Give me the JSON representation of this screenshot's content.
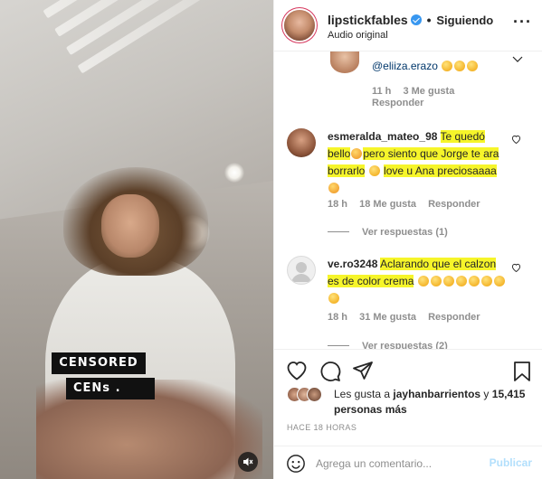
{
  "media": {
    "censor_text_1": "CENSORED",
    "censor_text_2": "CENs .",
    "audio_icon": "speaker-muted-icon"
  },
  "header": {
    "username": "lipstickfables",
    "separator": "•",
    "follow_label": "Siguiendo",
    "subtitle": "Audio original",
    "more_icon": "more-horizontal-icon"
  },
  "comments": [
    {
      "mention": "@eliiza.erazo",
      "emojis": [
        "laughing",
        "laughing",
        "laughing"
      ],
      "time": "11 h",
      "likes": "3 Me gusta",
      "reply": "Responder"
    },
    {
      "username": "esmeralda_mateo_98",
      "text_1": "Te quedó bello",
      "text_2": "pero siento que Jorge te ara borrarlo",
      "text_3": "love u Ana preciosaaaa",
      "time": "18 h",
      "likes": "18 Me gusta",
      "reply": "Responder",
      "view_replies": "Ver respuestas (1)"
    },
    {
      "username": "ve.ro3248",
      "text_1": "Aclarando que el calzon es de color crema",
      "time": "18 h",
      "likes": "31 Me gusta",
      "reply": "Responder",
      "view_replies": "Ver respuestas (2)"
    }
  ],
  "likes": {
    "prefix": "Les gusta a ",
    "user": "jayhanbarrientos",
    "middle": " y ",
    "count": "15,415 personas más"
  },
  "time_ago": "HACE 18 HORAS",
  "add_comment": {
    "placeholder": "Agrega un comentario...",
    "publish_label": "Publicar"
  },
  "colors": {
    "highlight": "#f6f52a",
    "link_blue": "#00376b",
    "publish_disabled": "#b2dffc",
    "verified": "#3897f0"
  }
}
